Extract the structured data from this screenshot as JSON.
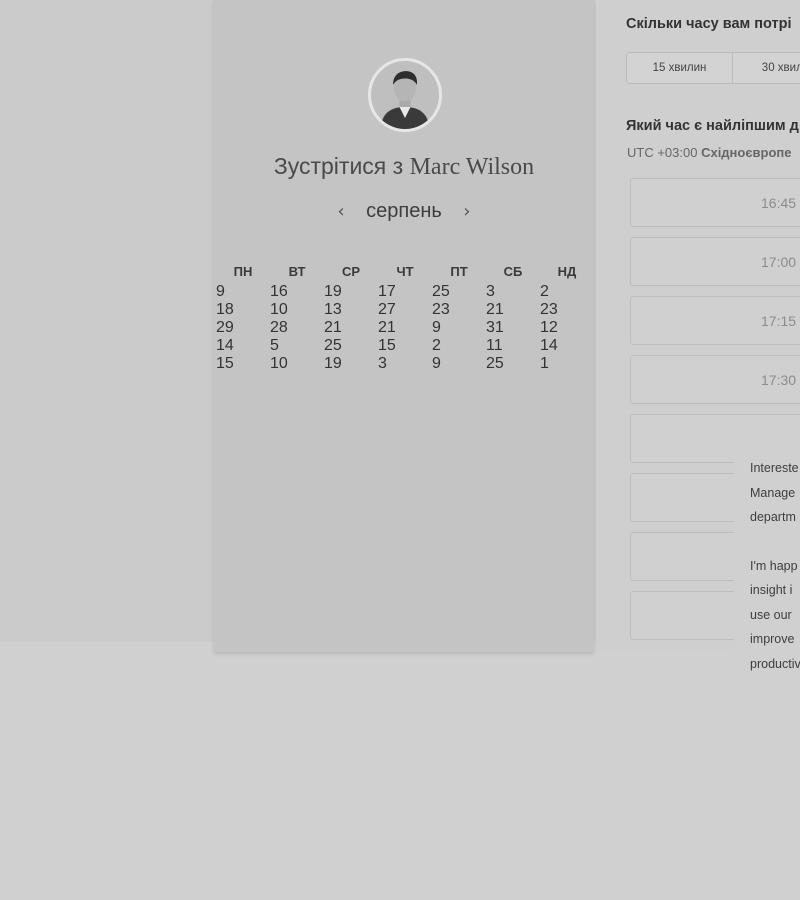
{
  "booking": {
    "heading_prefix": "Зустрітися з",
    "host_name": "Marc Wilson",
    "month": "серпень",
    "prev_icon": "chevron-left-icon",
    "next_icon": "chevron-right-icon"
  },
  "calendar": {
    "weekdays": [
      "ПН",
      "ВТ",
      "СР",
      "ЧТ",
      "ПТ",
      "СБ",
      "НД"
    ],
    "weeks": [
      [
        "9",
        "16",
        "19",
        "17",
        "25",
        "3",
        "2"
      ],
      [
        "18",
        "10",
        "13",
        "27",
        "23",
        "21",
        "23"
      ],
      [
        "29",
        "28",
        "21",
        "21",
        "9",
        "31",
        "12"
      ],
      [
        "14",
        "5",
        "25",
        "15",
        "2",
        "11",
        "14"
      ],
      [
        "15",
        "10",
        "19",
        "3",
        "9",
        "25",
        "1"
      ]
    ]
  },
  "duration": {
    "question": "Скільки часу вам потрі",
    "options": [
      "15 хвилин",
      "30 хвили"
    ]
  },
  "timeslots": {
    "question": "Який час є найліпшим д",
    "timezone_offset": "UTC +03:00",
    "timezone_name": "Східноєвропе",
    "slots": [
      "16:45",
      "17:00",
      "17:15",
      "17:30",
      "",
      "",
      "",
      ""
    ]
  },
  "tooltip": {
    "lines_1": [
      "Intereste",
      "Manage",
      "departm"
    ],
    "lines_2": [
      "I'm happ",
      "insight i",
      "use our",
      "improve",
      "productiv"
    ]
  }
}
